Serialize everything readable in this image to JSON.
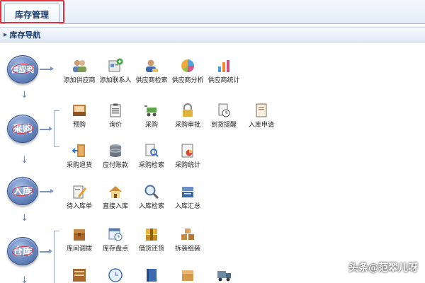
{
  "tabbar": {
    "active_tab": "库存管理"
  },
  "section": {
    "title": "库存导航"
  },
  "flow": {
    "nodes": [
      "供应商",
      "采购",
      "入库",
      "仓库"
    ]
  },
  "rows": {
    "supplier": [
      "添加供应商",
      "添加联系人",
      "供应商检索",
      "供应商分析",
      "供应商统计"
    ],
    "purchase1": [
      "预购",
      "询价",
      "采购",
      "采购审批",
      "到货提醒",
      "入库申请"
    ],
    "purchase2": [
      "采购退货",
      "应付账款",
      "采购检索",
      "采购统计"
    ],
    "inbound": [
      "待入库单",
      "直接入库",
      "入库检索",
      "入库汇总"
    ],
    "warehouse": [
      "库间调拨",
      "库存盘点",
      "借货还货",
      "拆装组装"
    ]
  },
  "watermark": "头条@范翠儿呀",
  "colors": {
    "accent_red": "#e5323a",
    "node_blue": "#4a6aa6",
    "header_blue": "#1d3f6d"
  }
}
